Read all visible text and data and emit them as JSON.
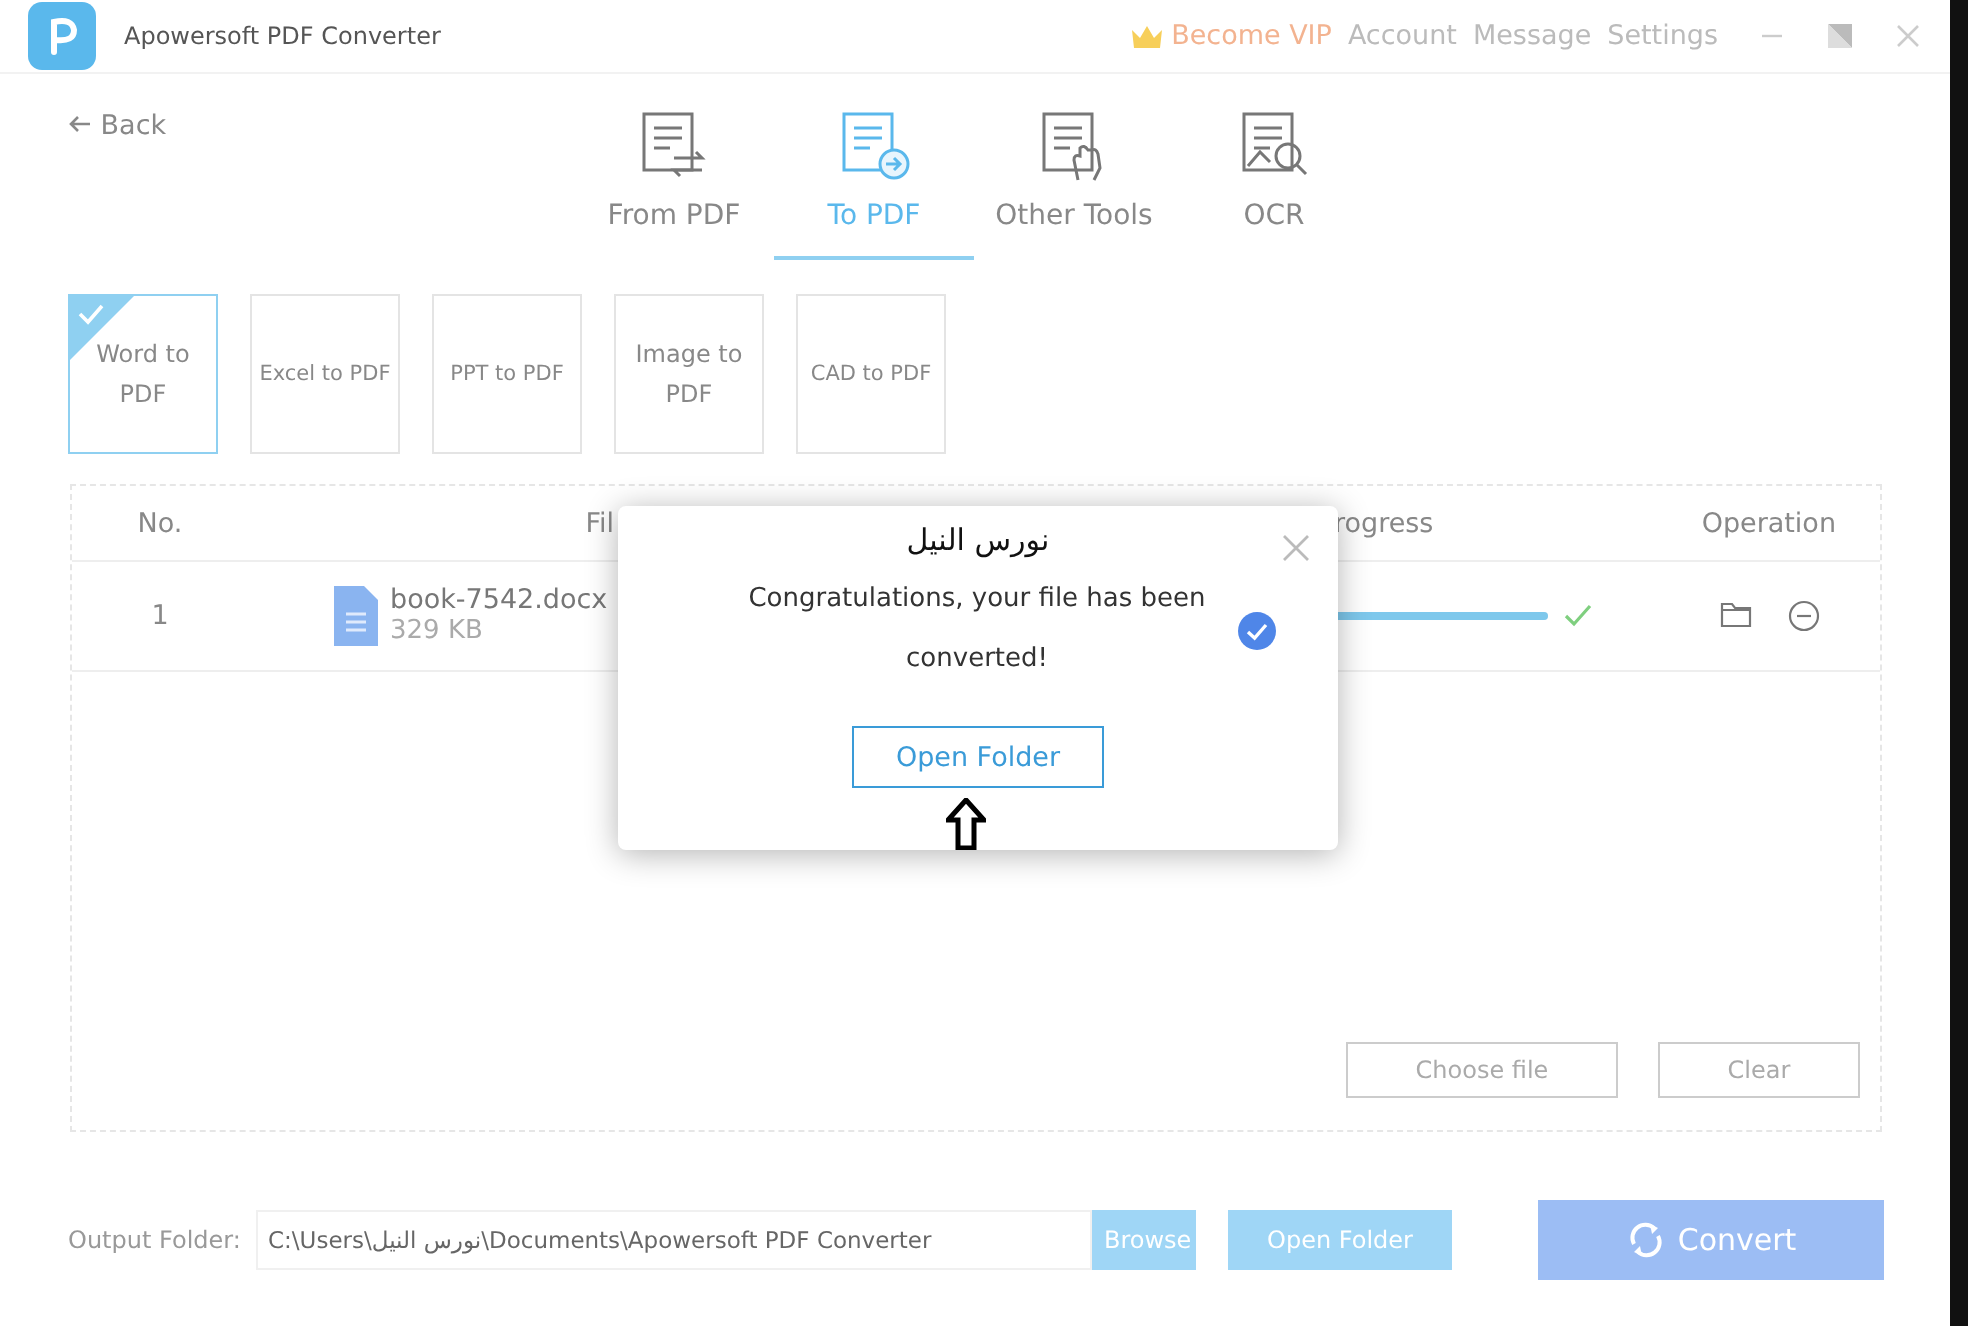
{
  "window": {
    "title": "Apowersoft PDF Converter",
    "links": [
      {
        "label": "Become VIP",
        "kind": "vip"
      },
      {
        "label": "Account",
        "kind": "plain"
      },
      {
        "label": "Message",
        "kind": "plain"
      },
      {
        "label": "Settings",
        "kind": "plain"
      }
    ]
  },
  "back": "Back",
  "tabs": [
    {
      "label": "From PDF",
      "kind": "from",
      "selected": false
    },
    {
      "label": "To PDF",
      "kind": "to",
      "selected": true
    },
    {
      "label": "Other Tools",
      "kind": "tools",
      "selected": false
    },
    {
      "label": "OCR",
      "kind": "ocr",
      "selected": false
    }
  ],
  "formats": [
    {
      "label": "Word to PDF",
      "selected": true
    },
    {
      "label": "Excel to PDF",
      "selected": false
    },
    {
      "label": "PPT to PDF",
      "selected": false
    },
    {
      "label": "Image to PDF",
      "selected": false
    },
    {
      "label": "CAD to PDF",
      "selected": false
    }
  ],
  "table": {
    "columns": [
      "No.",
      "Fil",
      "rogress",
      "Operation"
    ],
    "rows": [
      {
        "no": "1",
        "name": "book-7542.docx",
        "size": "329 KB",
        "level": 1,
        "done": true
      }
    ]
  },
  "actions": [
    "Choose file",
    "Clear"
  ],
  "dialog": {
    "title": "نورس النيل",
    "message": "Congratulations, your file has been converted!",
    "button": "Open Folder"
  },
  "output": {
    "label": "Output Folder:",
    "value": "C:\\Users\\نورس النيل\\Documents\\Apowersoft PDF Converter",
    "browse": "Browse",
    "open": "Open Folder",
    "convert": "Convert"
  }
}
